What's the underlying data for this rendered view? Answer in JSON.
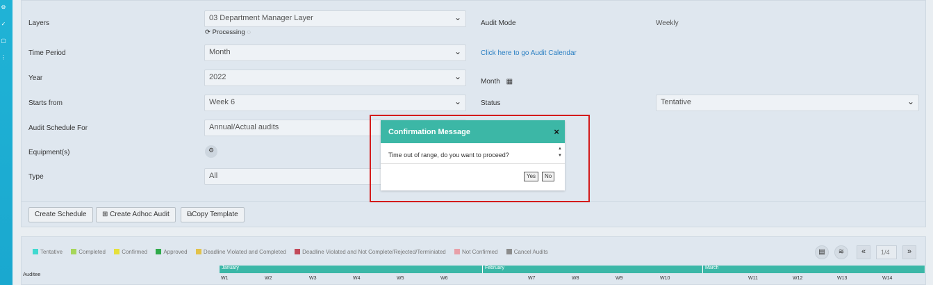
{
  "sidebar": {
    "icons": [
      "settings-icon",
      "check-icon",
      "square-icon",
      "list-icon"
    ]
  },
  "form": {
    "layers": {
      "label": "Layers",
      "value": "03 Department Manager Layer",
      "status": "Processing"
    },
    "time_period": {
      "label": "Time Period",
      "value": "Month"
    },
    "year": {
      "label": "Year",
      "value": "2022"
    },
    "starts_from": {
      "label": "Starts from",
      "value": "Week 6"
    },
    "audit_schedule_for": {
      "label": "Audit Schedule For",
      "value": "Annual/Actual audits"
    },
    "equipment": {
      "label": "Equipment(s)"
    },
    "type": {
      "label": "Type",
      "value": "All"
    },
    "audit_mode": {
      "label": "Audit Mode",
      "value": "Weekly"
    },
    "calendar_link": "Click here to go Audit Calendar",
    "month": {
      "label": "Month"
    },
    "status": {
      "label": "Status",
      "value": "Tentative"
    }
  },
  "buttons": {
    "create_schedule": "Create Schedule",
    "create_adhoc": "Create Adhoc Audit",
    "copy_template": "Copy Template"
  },
  "legend": [
    {
      "label": "Tentative",
      "color": "#40d9d0"
    },
    {
      "label": "Completed",
      "color": "#a6d65a"
    },
    {
      "label": "Confirmed",
      "color": "#e6e03a"
    },
    {
      "label": "Approved",
      "color": "#2faa4a"
    },
    {
      "label": "Deadline Violated and Completed",
      "color": "#e2c24a"
    },
    {
      "label": "Deadline Violated and Not Complete/Rejected/Terminiated",
      "color": "#c24a5a"
    },
    {
      "label": "Not Confirmed",
      "color": "#e8a0a8"
    },
    {
      "label": "Cancel Audits",
      "color": "#8c8c8c"
    }
  ],
  "pagination": {
    "value": "1/4",
    "first": "«",
    "last": "»"
  },
  "grid": {
    "auditee_header": "Auditee",
    "months": [
      "January",
      "February",
      "March"
    ],
    "weeks": [
      "W1",
      "W2",
      "W3",
      "W4",
      "W5",
      "W6",
      "W7",
      "W8",
      "W9",
      "W10",
      "W11",
      "W12",
      "W13",
      "W14"
    ]
  },
  "dialog": {
    "title": "Confirmation Message",
    "message": "Time out of range, do you want to proceed?",
    "yes": "Yes",
    "no": "No",
    "close": "×"
  }
}
